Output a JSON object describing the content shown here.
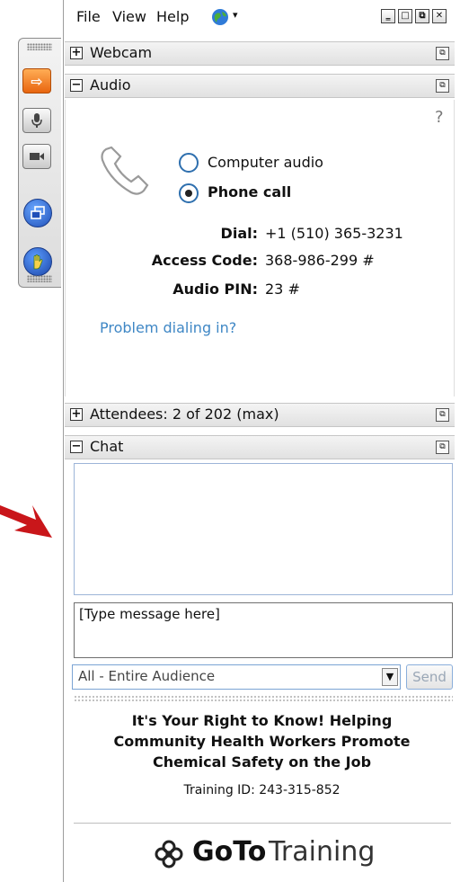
{
  "menu": {
    "file": "File",
    "view": "View",
    "help": "Help"
  },
  "window_buttons": [
    "minimize",
    "restore",
    "popout",
    "close"
  ],
  "panels": {
    "webcam": {
      "title": "Webcam",
      "toggle": "+"
    },
    "audio": {
      "title": "Audio",
      "toggle": "−",
      "help": "?",
      "options": [
        {
          "label": "Computer audio",
          "selected": false
        },
        {
          "label": "Phone call",
          "selected": true
        }
      ],
      "dial_label": "Dial:",
      "dial_value": "+1 (510) 365-3231",
      "access_label": "Access Code:",
      "access_value": "368-986-299 #",
      "pin_label": "Audio PIN:",
      "pin_value": "23 #",
      "problem_link": "Problem dialing in?"
    },
    "attendees": {
      "title": "Attendees:  2 of 202 (max)",
      "toggle": "+"
    },
    "chat": {
      "title": "Chat",
      "toggle": "−",
      "placeholder": "[Type message here]",
      "recipient": "All - Entire Audience",
      "send_label": "Send"
    }
  },
  "training": {
    "title_line1": "It's Your Right to Know! Helping",
    "title_line2": "Community Health Workers Promote",
    "title_line3": "Chemical Safety on the Job",
    "id_label": "Training ID: 243-315-852"
  },
  "brand": {
    "goto": "GoTo",
    "training": "Training"
  },
  "colors": {
    "link": "#3f87c5",
    "arrow": "#d11a1a",
    "accent": "#e8650f"
  }
}
